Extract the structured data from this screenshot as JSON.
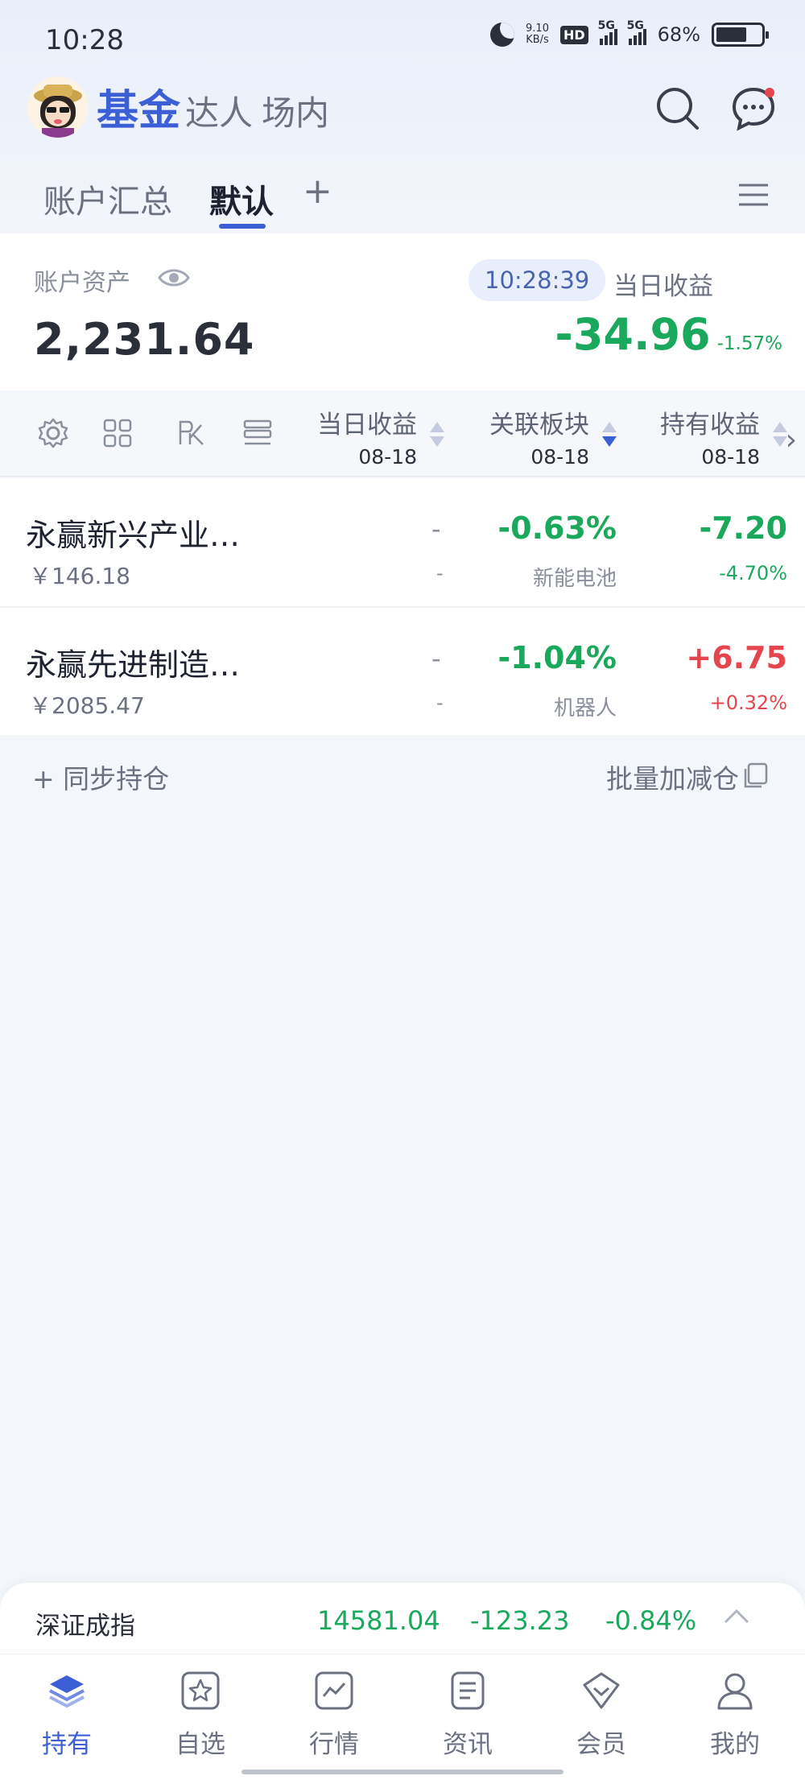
{
  "status_bar": {
    "time": "10:28",
    "net_speed": "9.10",
    "net_unit": "KB/s",
    "hd_label": "HD",
    "sim1": "5G",
    "sim2": "5G",
    "battery_pct": "68%",
    "battery_level": 0.68
  },
  "header": {
    "tabs": [
      "基金",
      "达人",
      "场内"
    ],
    "active_tab": 0,
    "has_notification": true
  },
  "subtabs": {
    "items": [
      "账户汇总",
      "默认"
    ],
    "active": 1,
    "add_label": "+"
  },
  "asset": {
    "label": "账户资产",
    "value": "2,231.64",
    "timestamp": "10:28:39",
    "daily_label": "当日收益",
    "daily_value": "-34.96",
    "daily_pct": "-1.57%"
  },
  "columns": [
    {
      "title": "当日收益",
      "date": "08-18"
    },
    {
      "title": "关联板块",
      "date": "08-18"
    },
    {
      "title": "持有收益",
      "date": "08-18"
    }
  ],
  "toolbar_icons": [
    "settings-icon",
    "grid-icon",
    "chart-rk-icon",
    "list-icon"
  ],
  "funds": [
    {
      "name": "永赢新兴产业…",
      "amount": "￥146.18",
      "daily": "-",
      "daily_sub": "-",
      "sector_change": "-0.63%",
      "sector": "新能电池",
      "hold_value": "-7.20",
      "hold_pct": "-4.70%",
      "hold_dir": "down"
    },
    {
      "name": "永赢先进制造…",
      "amount": "￥2085.47",
      "daily": "-",
      "daily_sub": "-",
      "sector_change": "-1.04%",
      "sector": "机器人",
      "hold_value": "+6.75",
      "hold_pct": "+0.32%",
      "hold_dir": "up"
    }
  ],
  "actions": {
    "sync": "+ 同步持仓",
    "batch": "批量加减仓"
  },
  "ticker": {
    "name": "深证成指",
    "value": "14581.04",
    "change": "-123.23",
    "pct": "-0.84%"
  },
  "bottom_nav": [
    {
      "label": "持有",
      "icon": "layers-icon"
    },
    {
      "label": "自选",
      "icon": "star-icon"
    },
    {
      "label": "行情",
      "icon": "chart-icon"
    },
    {
      "label": "资讯",
      "icon": "news-icon"
    },
    {
      "label": "会员",
      "icon": "diamond-icon"
    },
    {
      "label": "我的",
      "icon": "user-icon"
    }
  ],
  "colors": {
    "accent": "#3d5fd6",
    "up": "#e5454d",
    "down": "#1aa95c"
  }
}
